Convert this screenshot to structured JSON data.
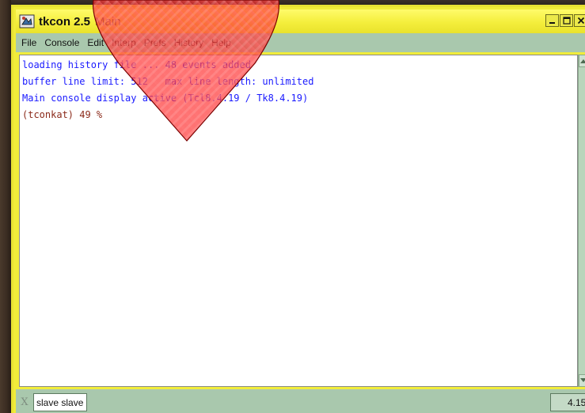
{
  "window": {
    "title": "tkcon 2.5",
    "subtitle": "Main"
  },
  "menu": {
    "items": [
      "File",
      "Console",
      "Edit",
      "Interp",
      "Prefs",
      "History",
      "Help"
    ]
  },
  "console": {
    "lines": [
      "loading history file ... 48 events added",
      "buffer line limit: 512   max line length: unlimited",
      "Main console display active (Tcl8.4.19 / Tk8.4.19)",
      "(tconkat) 49 %"
    ]
  },
  "status": {
    "x_label": "X",
    "interp": "slave slave",
    "version": "4.15"
  },
  "colors": {
    "window_frame": "#f1ec3a",
    "menubar": "#a9c8ad",
    "info_text": "#1a1aff",
    "prompt_text": "#8b2a1a",
    "overlay": "#ff3a3a"
  },
  "icons": {
    "app": "tkcon-app-icon",
    "minimize": "minimize-icon",
    "maximize": "maximize-icon",
    "close": "close-icon"
  }
}
